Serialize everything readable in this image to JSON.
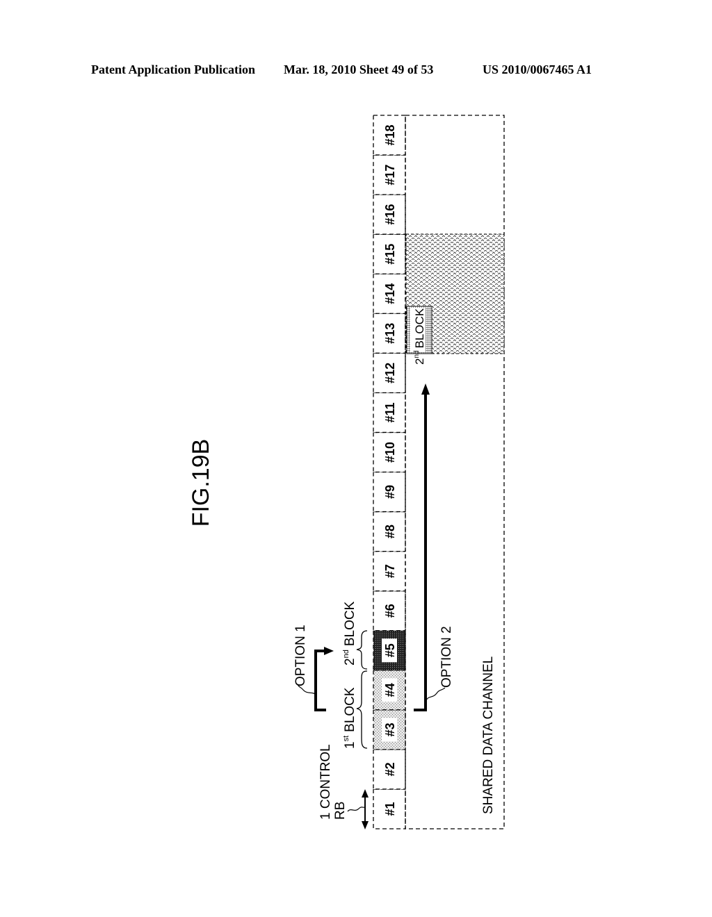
{
  "header": {
    "publication": "Patent Application Publication",
    "date_sheet": "Mar. 18, 2010  Sheet 49 of 53",
    "patent_number": "US 2010/0067465 A1"
  },
  "figure": {
    "title": "FIG.19B",
    "resource_blocks": [
      "#1",
      "#2",
      "#3",
      "#4",
      "#5",
      "#6",
      "#7",
      "#8",
      "#9",
      "#10",
      "#11",
      "#12",
      "#13",
      "#14",
      "#15",
      "#16",
      "#17",
      "#18"
    ],
    "first_block_rbs": [
      "#3",
      "#4"
    ],
    "second_block_rbs": [
      "#5"
    ],
    "labels": {
      "control_rb_line1": "1 CONTROL",
      "control_rb_line2": "RB",
      "first_block_num": "1",
      "first_block_sup": "st",
      "first_block_word": "BLOCK",
      "second_block_num": "2",
      "second_block_sup": "nd",
      "second_block_word": "BLOCK",
      "option1": "OPTION 1",
      "option2": "OPTION 2",
      "shared_data_channel": "SHARED DATA CHANNEL",
      "data_second_block_num": "2",
      "data_second_block_sup": "nd",
      "data_second_block_word": "BLOCK"
    },
    "data_region_rbs": [
      "#13",
      "#14",
      "#15"
    ],
    "colors": {
      "line": "#000000",
      "first_block_fill": "#c8c8c8",
      "second_block_fill": "#3a3a3a",
      "data_region_fill": "#d9d9d9"
    }
  }
}
